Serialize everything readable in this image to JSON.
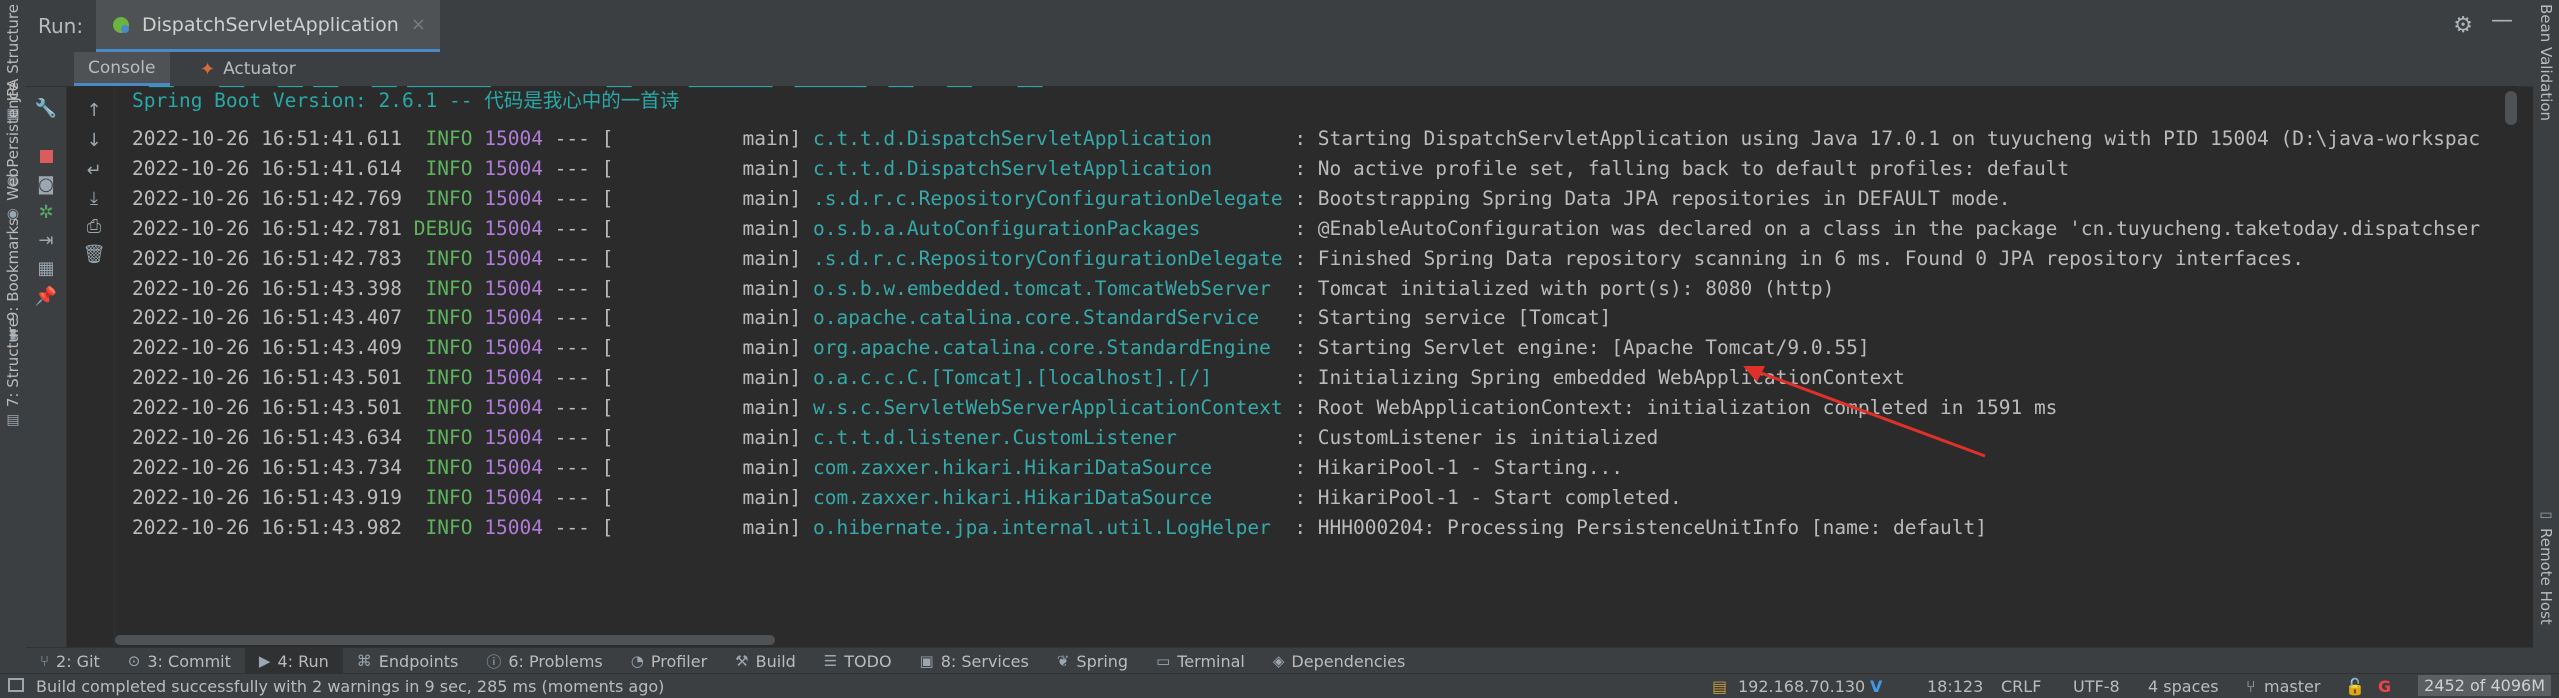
{
  "left_strip": {
    "tabs": [
      {
        "label": "JPA Structure",
        "icon": "jpa-icon"
      },
      {
        "label": "Persistence",
        "icon": "persistence-icon"
      },
      {
        "label": "Web",
        "icon": "web-icon"
      },
      {
        "label": "9: Bookmarks",
        "icon": "bookmark-icon"
      },
      {
        "label": "7: Structure",
        "icon": "structure-icon"
      }
    ]
  },
  "right_strip": {
    "tabs": [
      {
        "label": "Bean Validation",
        "icon": "bean-validation-icon"
      },
      {
        "label": "Remote Host",
        "icon": "remote-host-icon"
      }
    ]
  },
  "run_header": {
    "title": "Run:",
    "tab_label": "DispatchServletApplication",
    "close_glyph": "×"
  },
  "sub_tabs": {
    "console": "Console",
    "actuator": "Actuator"
  },
  "console": {
    "banner_fragment": " └─┘   └─┘  └─┘└─┘  └─┘└──────┘         └─┘    └──────┘ └─────┘ └─┘  └─┘   └─┘",
    "version_line": "Spring Boot Version: 2.6.1 -- 代码是我心中的一首诗",
    "log_lines": [
      {
        "ts": "2022-10-26 16:51:41.611",
        "level": " INFO",
        "pid": "15004",
        "thread": " --- [           main] ",
        "logger": "c.t.t.d.DispatchServletApplication      ",
        "msg": " : Starting DispatchServletApplication using Java 17.0.1 on tuyucheng with PID 15004 (D:\\java-workspac"
      },
      {
        "ts": "2022-10-26 16:51:41.614",
        "level": " INFO",
        "pid": "15004",
        "thread": " --- [           main] ",
        "logger": "c.t.t.d.DispatchServletApplication      ",
        "msg": " : No active profile set, falling back to default profiles: default"
      },
      {
        "ts": "2022-10-26 16:51:42.769",
        "level": " INFO",
        "pid": "15004",
        "thread": " --- [           main] ",
        "logger": ".s.d.r.c.RepositoryConfigurationDelegate",
        "msg": " : Bootstrapping Spring Data JPA repositories in DEFAULT mode."
      },
      {
        "ts": "2022-10-26 16:51:42.781",
        "level": "DEBUG",
        "pid": "15004",
        "thread": " --- [           main] ",
        "logger": "o.s.b.a.AutoConfigurationPackages       ",
        "msg": " : @EnableAutoConfiguration was declared on a class in the package 'cn.tuyucheng.taketoday.dispatchser"
      },
      {
        "ts": "2022-10-26 16:51:42.783",
        "level": " INFO",
        "pid": "15004",
        "thread": " --- [           main] ",
        "logger": ".s.d.r.c.RepositoryConfigurationDelegate",
        "msg": " : Finished Spring Data repository scanning in 6 ms. Found 0 JPA repository interfaces."
      },
      {
        "ts": "2022-10-26 16:51:43.398",
        "level": " INFO",
        "pid": "15004",
        "thread": " --- [           main] ",
        "logger": "o.s.b.w.embedded.tomcat.TomcatWebServer ",
        "msg": " : Tomcat initialized with port(s): 8080 (http)"
      },
      {
        "ts": "2022-10-26 16:51:43.407",
        "level": " INFO",
        "pid": "15004",
        "thread": " --- [           main] ",
        "logger": "o.apache.catalina.core.StandardService  ",
        "msg": " : Starting service [Tomcat]"
      },
      {
        "ts": "2022-10-26 16:51:43.409",
        "level": " INFO",
        "pid": "15004",
        "thread": " --- [           main] ",
        "logger": "org.apache.catalina.core.StandardEngine ",
        "msg": " : Starting Servlet engine: [Apache Tomcat/9.0.55]"
      },
      {
        "ts": "2022-10-26 16:51:43.501",
        "level": " INFO",
        "pid": "15004",
        "thread": " --- [           main] ",
        "logger": "o.a.c.c.C.[Tomcat].[localhost].[/]      ",
        "msg": " : Initializing Spring embedded WebApplicationContext"
      },
      {
        "ts": "2022-10-26 16:51:43.501",
        "level": " INFO",
        "pid": "15004",
        "thread": " --- [           main] ",
        "logger": "w.s.c.ServletWebServerApplicationContext",
        "msg": " : Root WebApplicationContext: initialization completed in 1591 ms"
      },
      {
        "ts": "2022-10-26 16:51:43.634",
        "level": " INFO",
        "pid": "15004",
        "thread": " --- [           main] ",
        "logger": "c.t.t.d.listener.CustomListener         ",
        "msg": " : CustomListener is initialized"
      },
      {
        "ts": "2022-10-26 16:51:43.734",
        "level": " INFO",
        "pid": "15004",
        "thread": " --- [           main] ",
        "logger": "com.zaxxer.hikari.HikariDataSource      ",
        "msg": " : HikariPool-1 - Starting..."
      },
      {
        "ts": "2022-10-26 16:51:43.919",
        "level": " INFO",
        "pid": "15004",
        "thread": " --- [           main] ",
        "logger": "com.zaxxer.hikari.HikariDataSource      ",
        "msg": " : HikariPool-1 - Start completed."
      },
      {
        "ts": "2022-10-26 16:51:43.982",
        "level": " INFO",
        "pid": "15004",
        "thread": " --- [           main] ",
        "logger": "o.hibernate.jpa.internal.util.LogHelper ",
        "msg": " : HHH000204: Processing PersistenceUnitInfo [name: default]"
      }
    ]
  },
  "tool_windows": [
    {
      "label": "2: Git",
      "icon": "git-icon"
    },
    {
      "label": "3: Commit",
      "icon": "commit-icon"
    },
    {
      "label": "4: Run",
      "icon": "run-icon",
      "active": true
    },
    {
      "label": "Endpoints",
      "icon": "endpoints-icon"
    },
    {
      "label": "6: Problems",
      "icon": "problems-icon"
    },
    {
      "label": "Profiler",
      "icon": "profiler-icon"
    },
    {
      "label": "Build",
      "icon": "build-icon"
    },
    {
      "label": "TODO",
      "icon": "todo-icon"
    },
    {
      "label": "8: Services",
      "icon": "services-icon"
    },
    {
      "label": "Spring",
      "icon": "spring-icon"
    },
    {
      "label": "Terminal",
      "icon": "terminal-icon"
    },
    {
      "label": "Dependencies",
      "icon": "dependencies-icon"
    }
  ],
  "status_bar": {
    "message": "Build completed successfully with 2 warnings in 9 sec, 285 ms (moments ago)",
    "ip": "192.168.70.130",
    "position": "18:123",
    "line_ending": "CRLF",
    "encoding": "UTF-8",
    "indent": "4 spaces",
    "branch": "master",
    "memory": "2452 of 4096M"
  },
  "colors": {
    "background": "#2b2b2b",
    "panel": "#3c3f41",
    "accent": "#4a88c7",
    "logger": "#35a9a9",
    "level": "#5fb35f",
    "pid": "#b07cd8",
    "annotation_arrow": "#e0302a"
  }
}
